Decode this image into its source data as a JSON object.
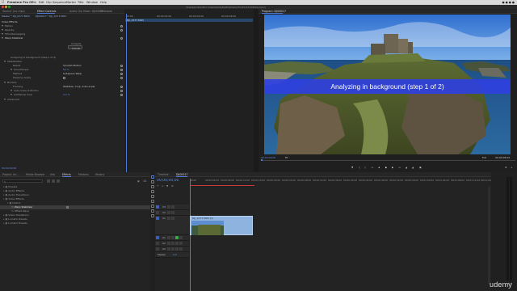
{
  "menubar": {
    "app": "Premiere Pro CC",
    "items": [
      "File",
      "Edit",
      "Clip",
      "Sequence",
      "Marker",
      "Title",
      "Window",
      "Help"
    ]
  },
  "titlebar": {
    "path": "/Users/jordan/Documents/Adobe/Premiere Pro/10.0/Untitled.prproj"
  },
  "effect_controls": {
    "tabs": [
      "Source: (no clips)",
      "Effect Controls",
      "Audio Clip Mixer: DJI00017",
      "Metadata"
    ],
    "source_label": "Master * DJI_0177.MOV",
    "clip_label": "DJI00017 * DJI_0177.MOV",
    "section_video": "Video Effects",
    "rows": [
      "Motion",
      "Opacity",
      "Time Remapping",
      "Warp Stabilizer"
    ],
    "analysis_label": "Analysis",
    "cancel_label": "Cancel",
    "status_text": "Analyzing in background (step 1 of 2)",
    "stabilization": "Stabilization",
    "result_label": "Result",
    "result_value": "Smooth Motion",
    "smoothness_label": "Smoothness",
    "smoothness_value": "50 %",
    "method_label": "Method",
    "method_value": "Subspace Warp",
    "preserve_scale": "Preserve Scale",
    "borders": "Borders",
    "framing_label": "Framing",
    "framing_value": "Stabilize, Crop, Auto-scale",
    "auto_scale": "Auto-scale (100.0%)",
    "additional_crop": "Additional Crop",
    "crop_value": "0.0 %",
    "advanced": "Advanced",
    "audio_effects": "Audio Effects",
    "timecode": "00;00;00;00",
    "ruler": [
      "00;00",
      "00;00;02;00",
      "00;00;04;00",
      "00;00;06;00"
    ],
    "clip_bar_label": "DJI_0177.MOV"
  },
  "program_monitor": {
    "title": "Program: DJI00017",
    "banner_text": "Analyzing in background (step 1 of 2)",
    "timecode_left": "00;00;00;00",
    "fit": "Fit",
    "quality": "Full",
    "timecode_right": "00;00;08;15"
  },
  "effects_panel": {
    "tabs": [
      "Project: Un...",
      "Media Browser",
      "Info",
      "Effects",
      "Markers",
      "History"
    ],
    "search_value": "",
    "tree": [
      {
        "label": "Presets",
        "indent": 0
      },
      {
        "label": "Audio Effects",
        "indent": 0
      },
      {
        "label": "Audio Transitions",
        "indent": 0
      },
      {
        "label": "Video Effects",
        "indent": 0
      },
      {
        "label": "Distort",
        "indent": 1
      },
      {
        "label": "Warp Stabilizer",
        "indent": 2
      },
      {
        "label": "Offset Wave",
        "indent": 2
      },
      {
        "label": "Video Transitions",
        "indent": 0
      },
      {
        "label": "Lumetri Presets",
        "indent": 0
      },
      {
        "label": "Lumetri Presets",
        "indent": 0
      }
    ]
  },
  "timeline": {
    "tabs": [
      "Timeline",
      "DJI00017"
    ],
    "timecode": "00;00;00;00",
    "ruler": [
      "00;00",
      "00;00;04;00",
      "00;00;08;00",
      "00;00;12;00",
      "00;00;16;00",
      "00;00;20;00",
      "00;00;24;00",
      "00;00;28;00",
      "00;00;32;00",
      "00;00;36;00",
      "00;00;40;00",
      "00;00;44;00",
      "00;00;48;00",
      "00;00;52;00",
      "00;00;56;00",
      "00;01;00;02",
      "00;01;04;02",
      "00;01;08;02",
      "00;01;12;02",
      "00;01;16;02"
    ],
    "tracks_video": [
      "V3",
      "V2",
      "V1"
    ],
    "tracks_audio": [
      "A1",
      "A2",
      "A3"
    ],
    "master": "Master",
    "master_value": "0.0",
    "clip_label": "DJI_0177.MOV [V]"
  },
  "watermark": "udemy",
  "colors": {
    "accent": "#4f7ad9",
    "banner": "#2f40e0",
    "clip": "#8fb3df",
    "green": "#3aa64a"
  }
}
